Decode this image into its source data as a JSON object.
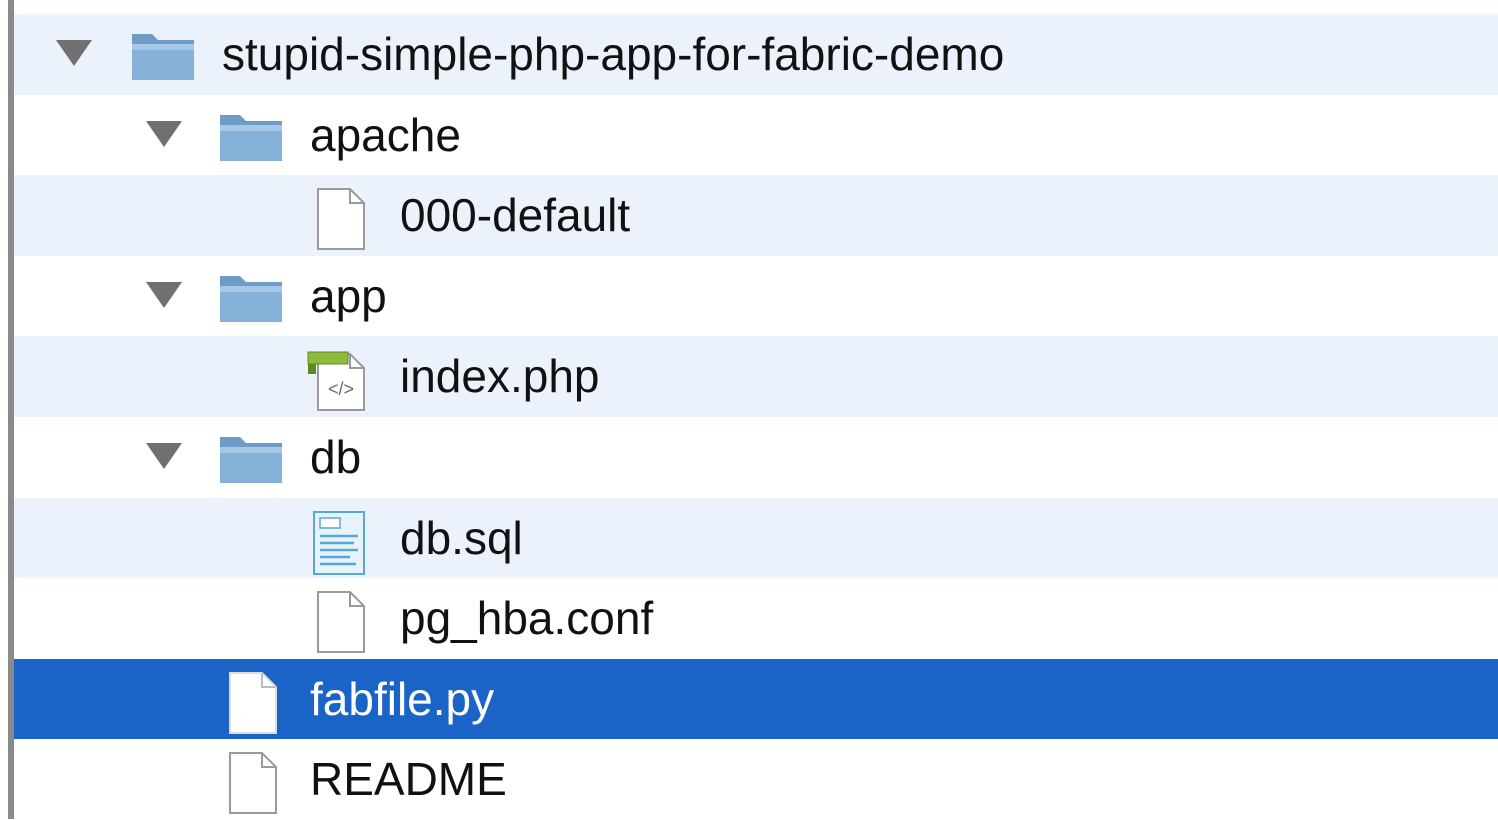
{
  "window": {
    "rows": [
      {
        "name": "stupid-simple-php-app-for-fabric-demo",
        "kind": "folder",
        "depth": 0,
        "expanded": true,
        "icon": "folder-icon"
      },
      {
        "name": "apache",
        "kind": "folder",
        "depth": 1,
        "expanded": true,
        "icon": "folder-icon"
      },
      {
        "name": "000-default",
        "kind": "file",
        "depth": 2,
        "icon": "document-icon"
      },
      {
        "name": "app",
        "kind": "folder",
        "depth": 1,
        "expanded": true,
        "icon": "folder-icon"
      },
      {
        "name": "index.php",
        "kind": "php",
        "depth": 2,
        "icon": "php-file-icon"
      },
      {
        "name": "db",
        "kind": "folder",
        "depth": 1,
        "expanded": true,
        "icon": "folder-icon"
      },
      {
        "name": "db.sql",
        "kind": "sql",
        "depth": 2,
        "icon": "sql-file-icon"
      },
      {
        "name": "pg_hba.conf",
        "kind": "file",
        "depth": 2,
        "icon": "document-icon"
      },
      {
        "name": "fabfile.py",
        "kind": "file",
        "depth": 1,
        "selected": true,
        "icon": "document-icon"
      },
      {
        "name": "README",
        "kind": "file",
        "depth": 1,
        "icon": "document-icon"
      }
    ]
  },
  "colors": {
    "selection": "#1a64c8",
    "alternate_row": "#ecf2fb",
    "folder": "#7fa9cf"
  }
}
